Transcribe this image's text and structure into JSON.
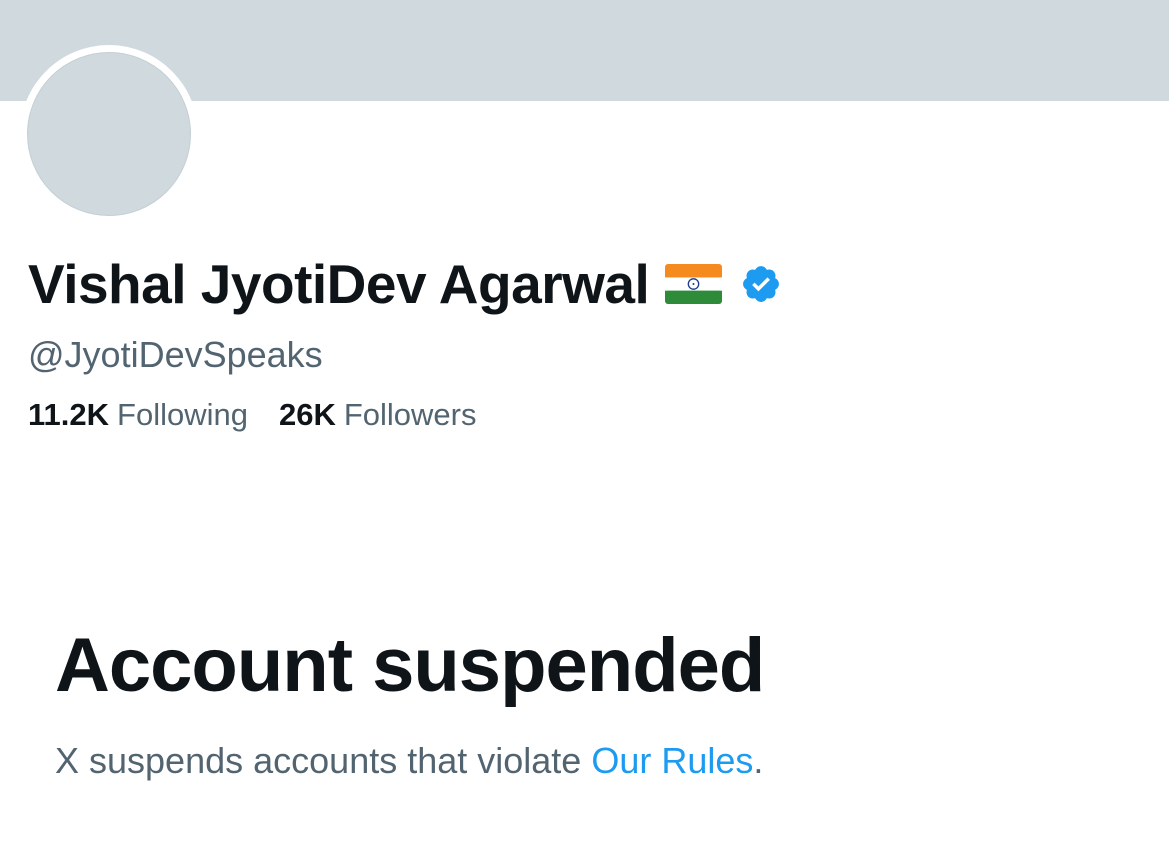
{
  "profile": {
    "display_name": "Vishal JyotiDev Agarwal",
    "flag_icon": "india-flag-icon",
    "verified_icon": "verified-badge-icon",
    "handle": "@JyotiDevSpeaks",
    "following_count": "11.2K",
    "following_label": "Following",
    "followers_count": "26K",
    "followers_label": "Followers"
  },
  "suspension": {
    "title": "Account suspended",
    "message_prefix": "X suspends accounts that violate ",
    "link_text": "Our Rules",
    "message_suffix": "."
  },
  "colors": {
    "banner": "#cfd9de",
    "avatar": "#cfd9de",
    "text_primary": "#0f1419",
    "text_secondary": "#536471",
    "link": "#1d9bf0",
    "verified": "#1d9bf0"
  }
}
